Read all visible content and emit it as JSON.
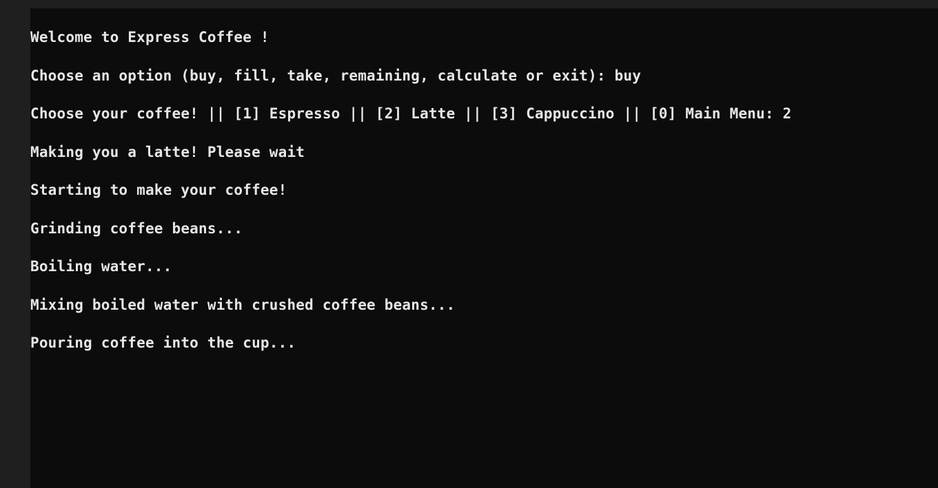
{
  "terminal": {
    "lines": [
      "Welcome to Express Coffee !",
      "Choose an option (buy, fill, take, remaining, calculate or exit): buy",
      "Choose your coffee! || [1] Espresso || [2] Latte || [3] Cappuccino || [0] Main Menu: 2",
      "Making you a latte! Please wait",
      "Starting to make your coffee!",
      "Grinding coffee beans...",
      "Boiling water...",
      "Mixing boiled water with crushed coffee beans...",
      "Pouring coffee into the cup..."
    ]
  },
  "colors": {
    "background": "#0c0c0c",
    "foreground": "#e6e6e6",
    "chrome": "#1f1f1f"
  }
}
